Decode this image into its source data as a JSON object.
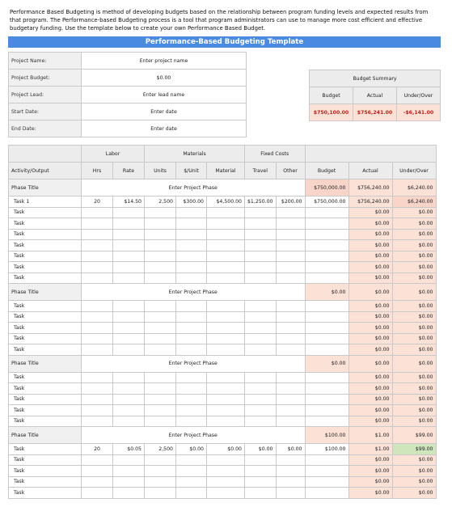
{
  "intro": "Performance Based Budgeting is method of developing budgets based on the relationship between program funding levels and expected results from that program. The Performance-based Budgeting process is a tool that program administrators can use to manage more cost efficient and effective budgetary funding. Use the template below to create your own Performance Based Budget.",
  "title": "Performance-Based Budgeting Template",
  "project": {
    "rows": [
      {
        "label": "Project Name:",
        "value": "Enter project name"
      },
      {
        "label": "Project Budget:",
        "value": "$0.00"
      },
      {
        "label": "Project Lead:",
        "value": "Enter lead name"
      },
      {
        "label": "Start Date:",
        "value": "Enter date"
      },
      {
        "label": "End Date:",
        "value": "Enter date"
      }
    ]
  },
  "summary": {
    "title": "Budget Summary",
    "headers": [
      "Budget",
      "Actual",
      "Under/Over"
    ],
    "values": [
      "$750,100.00",
      "$756,241.00",
      "-$6,141.00"
    ]
  },
  "headers": {
    "group": {
      "labor": "Labor",
      "materials": "Materials",
      "fixed": "Fixed Costs"
    },
    "activity": "Activity/Output",
    "cols": [
      "Hrs",
      "Rate",
      "Units",
      "$/Unit",
      "Material",
      "Travel",
      "Other",
      "Budget",
      "Actual",
      "Under/Over"
    ]
  },
  "phases": [
    {
      "title": "Phase Title",
      "phase_label": "Enter Project Phase",
      "budget": "$750,000.00",
      "actual": "$756,240.00",
      "under": "$6,240.00",
      "tasks": [
        {
          "name": "Task 1",
          "hrs": "20",
          "rate": "$14.50",
          "units": "2,500",
          "unit": "$300.00",
          "material": "$4,500.00",
          "travel": "$1,250.00",
          "other": "$200.00",
          "budget": "$750,000.00",
          "actual": "$756,240.00",
          "under": "$6,240.00"
        },
        {
          "name": "Task",
          "hrs": "",
          "rate": "",
          "units": "",
          "unit": "",
          "material": "",
          "travel": "",
          "other": "",
          "budget": "",
          "actual": "$0.00",
          "under": "$0.00"
        },
        {
          "name": "Task",
          "hrs": "",
          "rate": "",
          "units": "",
          "unit": "",
          "material": "",
          "travel": "",
          "other": "",
          "budget": "",
          "actual": "$0.00",
          "under": "$0.00"
        },
        {
          "name": "Task",
          "hrs": "",
          "rate": "",
          "units": "",
          "unit": "",
          "material": "",
          "travel": "",
          "other": "",
          "budget": "",
          "actual": "$0.00",
          "under": "$0.00"
        },
        {
          "name": "Task",
          "hrs": "",
          "rate": "",
          "units": "",
          "unit": "",
          "material": "",
          "travel": "",
          "other": "",
          "budget": "",
          "actual": "$0.00",
          "under": "$0.00"
        },
        {
          "name": "Task",
          "hrs": "",
          "rate": "",
          "units": "",
          "unit": "",
          "material": "",
          "travel": "",
          "other": "",
          "budget": "",
          "actual": "$0.00",
          "under": "$0.00"
        },
        {
          "name": "Task",
          "hrs": "",
          "rate": "",
          "units": "",
          "unit": "",
          "material": "",
          "travel": "",
          "other": "",
          "budget": "",
          "actual": "$0.00",
          "under": "$0.00"
        },
        {
          "name": "Task",
          "hrs": "",
          "rate": "",
          "units": "",
          "unit": "",
          "material": "",
          "travel": "",
          "other": "",
          "budget": "",
          "actual": "$0.00",
          "under": "$0.00"
        }
      ]
    },
    {
      "title": "Phase Title",
      "phase_label": "Enter Project Phase",
      "budget": "$0.00",
      "actual": "$0.00",
      "under": "$0.00",
      "tasks": [
        {
          "name": "Task",
          "hrs": "",
          "rate": "",
          "units": "",
          "unit": "",
          "material": "",
          "travel": "",
          "other": "",
          "budget": "",
          "actual": "$0.00",
          "under": "$0.00"
        },
        {
          "name": "Task",
          "hrs": "",
          "rate": "",
          "units": "",
          "unit": "",
          "material": "",
          "travel": "",
          "other": "",
          "budget": "",
          "actual": "$0.00",
          "under": "$0.00"
        },
        {
          "name": "Task",
          "hrs": "",
          "rate": "",
          "units": "",
          "unit": "",
          "material": "",
          "travel": "",
          "other": "",
          "budget": "",
          "actual": "$0.00",
          "under": "$0.00"
        },
        {
          "name": "Task",
          "hrs": "",
          "rate": "",
          "units": "",
          "unit": "",
          "material": "",
          "travel": "",
          "other": "",
          "budget": "",
          "actual": "$0.00",
          "under": "$0.00"
        },
        {
          "name": "Task",
          "hrs": "",
          "rate": "",
          "units": "",
          "unit": "",
          "material": "",
          "travel": "",
          "other": "",
          "budget": "",
          "actual": "$0.00",
          "under": "$0.00"
        }
      ]
    },
    {
      "title": "Phase Title",
      "phase_label": "Enter Project Phase",
      "budget": "$0.00",
      "actual": "$0.00",
      "under": "$0.00",
      "tasks": [
        {
          "name": "Task",
          "hrs": "",
          "rate": "",
          "units": "",
          "unit": "",
          "material": "",
          "travel": "",
          "other": "",
          "budget": "",
          "actual": "$0.00",
          "under": "$0.00"
        },
        {
          "name": "Task",
          "hrs": "",
          "rate": "",
          "units": "",
          "unit": "",
          "material": "",
          "travel": "",
          "other": "",
          "budget": "",
          "actual": "$0.00",
          "under": "$0.00"
        },
        {
          "name": "Task",
          "hrs": "",
          "rate": "",
          "units": "",
          "unit": "",
          "material": "",
          "travel": "",
          "other": "",
          "budget": "",
          "actual": "$0.00",
          "under": "$0.00"
        },
        {
          "name": "Task",
          "hrs": "",
          "rate": "",
          "units": "",
          "unit": "",
          "material": "",
          "travel": "",
          "other": "",
          "budget": "",
          "actual": "$0.00",
          "under": "$0.00"
        },
        {
          "name": "Task",
          "hrs": "",
          "rate": "",
          "units": "",
          "unit": "",
          "material": "",
          "travel": "",
          "other": "",
          "budget": "",
          "actual": "$0.00",
          "under": "$0.00"
        }
      ]
    },
    {
      "title": "Phase Title",
      "phase_label": "Enter Project Phase",
      "budget": "$100.00",
      "actual": "$1.00",
      "under": "$99.00",
      "tasks": [
        {
          "name": "Task",
          "hrs": "20",
          "rate": "$0.05",
          "units": "2,500",
          "unit": "$0.00",
          "material": "$0.00",
          "travel": "$0.00",
          "other": "$0.00",
          "budget": "$100.00",
          "actual": "$1.00",
          "under": "$99.00"
        },
        {
          "name": "Task",
          "hrs": "",
          "rate": "",
          "units": "",
          "unit": "",
          "material": "",
          "travel": "",
          "other": "",
          "budget": "",
          "actual": "$0.00",
          "under": "$0.00"
        },
        {
          "name": "Task",
          "hrs": "",
          "rate": "",
          "units": "",
          "unit": "",
          "material": "",
          "travel": "",
          "other": "",
          "budget": "",
          "actual": "$0.00",
          "under": "$0.00"
        },
        {
          "name": "Task",
          "hrs": "",
          "rate": "",
          "units": "",
          "unit": "",
          "material": "",
          "travel": "",
          "other": "",
          "budget": "",
          "actual": "$0.00",
          "under": "$0.00"
        },
        {
          "name": "Task",
          "hrs": "",
          "rate": "",
          "units": "",
          "unit": "",
          "material": "",
          "travel": "",
          "other": "",
          "budget": "",
          "actual": "$0.00",
          "under": "$0.00"
        }
      ]
    }
  ]
}
